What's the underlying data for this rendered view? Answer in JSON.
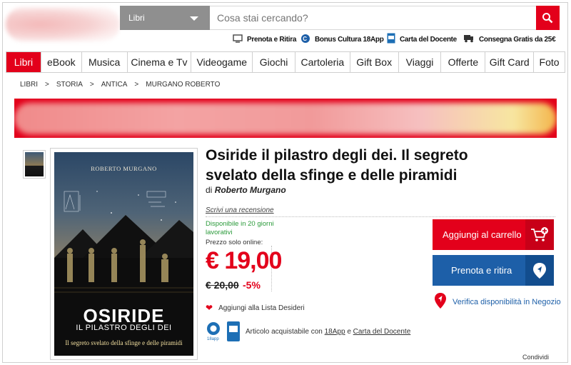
{
  "header": {
    "category_select": "Libri",
    "search_placeholder": "Cosa stai cercando?"
  },
  "services": [
    {
      "label": "Prenota e Ritira",
      "icon": "monitor-icon"
    },
    {
      "label": "Bonus Cultura 18App",
      "icon": "18app-icon"
    },
    {
      "label": "Carta del Docente",
      "icon": "docente-card-icon"
    },
    {
      "label": "Consegna Gratis da 25€",
      "icon": "truck-icon"
    }
  ],
  "nav": [
    {
      "label": "Libri",
      "active": true
    },
    {
      "label": "eBook"
    },
    {
      "label": "Musica"
    },
    {
      "label": "Cinema e Tv"
    },
    {
      "label": "Videogame"
    },
    {
      "label": "Giochi"
    },
    {
      "label": "Cartoleria"
    },
    {
      "label": "Gift Box"
    },
    {
      "label": "Viaggi"
    },
    {
      "label": "Offerte"
    },
    {
      "label": "Gift Card"
    },
    {
      "label": "Foto"
    }
  ],
  "breadcrumb": [
    "LIBRI",
    "STORIA",
    "ANTICA",
    "MURGANO ROBERTO"
  ],
  "breadcrumb_sep": ">",
  "cover": {
    "author": "ROBERTO MURGANO",
    "title": "OSIRIDE",
    "subtitle": "IL PILASTRO DEGLI DEI",
    "tagline": "Il segreto svelato della sfinge e delle piramidi"
  },
  "product": {
    "title": "Osiride il pilastro degli dei. Il segreto svelato della sfinge e delle piramidi",
    "by_prefix": "di",
    "author": "Roberto Murgano",
    "review_link": "Scrivi una recensione",
    "availability": "Disponibile in 20 giorni lavorativi",
    "price_label": "Prezzo solo online:",
    "price": "€ 19,00",
    "old_price": "€ 20,00",
    "discount": "-5%",
    "wishlist": "Aggiungi alla Lista Desideri",
    "bonus_prefix": "Articolo acquistabile con",
    "bonus_18app": "18App",
    "bonus_and": "e",
    "bonus_docente": "Carta del Docente"
  },
  "actions": {
    "add_to_cart": "Aggiungi al carrello",
    "reserve": "Prenota e ritira",
    "verify": "Verifica disponibilità in Negozio"
  },
  "share": "Condividi",
  "colors": {
    "brand_red": "#e3001b",
    "brand_blue": "#1d5fa8",
    "availability_green": "#2a9a3a"
  }
}
